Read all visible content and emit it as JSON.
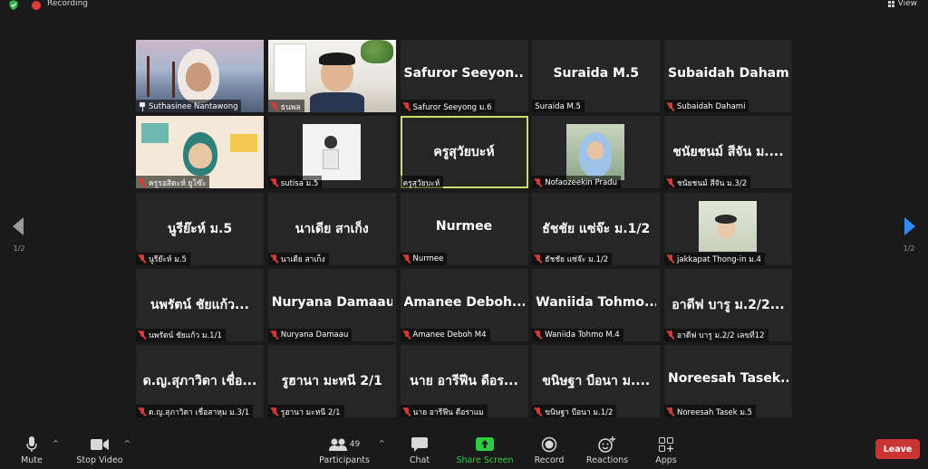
{
  "topbar": {
    "recording_label": "Recording",
    "view_label": "View"
  },
  "nav": {
    "page_indicator_left": "1/2",
    "page_indicator_right": "1/2"
  },
  "participants": [
    {
      "big_name": "",
      "label": "Suthasinee Nantawong",
      "icon": "pin-icon",
      "video": "sea"
    },
    {
      "big_name": "",
      "label": "ธนพล",
      "icon": "mic-off-icon",
      "video": "room"
    },
    {
      "big_name": "Safuror  Seeyon...",
      "label": "Safuror Seeyong ม.6",
      "icon": "mic-off-icon",
      "video": ""
    },
    {
      "big_name": "Suraida M.5",
      "label": "Suraida M.5",
      "icon": "",
      "video": ""
    },
    {
      "big_name": "Subaidah Dahami",
      "label": "Subaidah Dahami",
      "icon": "mic-off-icon",
      "video": ""
    },
    {
      "big_name": "",
      "label": "ครูรอสิดะห์ ยูโซ๊ะ",
      "icon": "mic-off-icon",
      "video": "cartoon"
    },
    {
      "big_name": "",
      "label": "sutisa ม.5",
      "icon": "mic-off-icon",
      "video": "thumb-girl"
    },
    {
      "big_name": "ครูสุวัยบะห์",
      "label": "ครูสุวัยบะห์",
      "icon": "",
      "video": "",
      "active": true
    },
    {
      "big_name": "",
      "label": "Nofaozeekin Pradu",
      "icon": "mic-off-icon",
      "video": "thumb-hijab"
    },
    {
      "big_name": "ชนัยชนม์ สีจัน ม....",
      "label": "ชนัยชนม์ สีจัน ม.3/2",
      "icon": "mic-off-icon",
      "video": ""
    },
    {
      "big_name": "นูรีย๊ะห์ ม.5",
      "label": "นูรีย๊ะห์ ม.5",
      "icon": "mic-off-icon",
      "video": ""
    },
    {
      "big_name": "นาเดีย สาเก็ง",
      "label": "นาเดีย สาเก็ง",
      "icon": "mic-off-icon",
      "video": ""
    },
    {
      "big_name": "Nurmee",
      "label": "Nurmee",
      "icon": "mic-off-icon",
      "video": ""
    },
    {
      "big_name": "ธัชชัย แซ่จ๊ะ ม.1/2",
      "label": "ธัชชัย แซ่จ๊ะ ม.1/2",
      "icon": "mic-off-icon",
      "video": ""
    },
    {
      "big_name": "",
      "label": "jakkapat Thong-in ม.4",
      "icon": "mic-off-icon",
      "video": "thumb-boy"
    },
    {
      "big_name": "นพรัตน์ ชัยแก้ว...",
      "label": "นพรัตน์ ชัยแก้ว ม.1/1",
      "icon": "mic-off-icon",
      "video": ""
    },
    {
      "big_name": "Nuryana Damaau",
      "label": "Nuryana Damaau",
      "icon": "mic-off-icon",
      "video": ""
    },
    {
      "big_name": "Amanee  Deboh...",
      "label": "Amanee Deboh M4",
      "icon": "mic-off-icon",
      "video": ""
    },
    {
      "big_name": "Waniida  Tohmo...",
      "label": "Waniida Tohmo M.4",
      "icon": "mic-off-icon",
      "video": ""
    },
    {
      "big_name": "อาดีฟ บารู ม.2/2...",
      "label": "อาดีฟ บารู ม.2/2 เลขที่12",
      "icon": "mic-off-icon",
      "video": ""
    },
    {
      "big_name": "ด.ญ.สุภาวิดา เชื่อ...",
      "label": "ด.ญ.สุภาวิดา เชื่อสาหุม ม.3/1",
      "icon": "mic-off-icon",
      "video": ""
    },
    {
      "big_name": "รูฮานา มะหนี 2/1",
      "label": "รูฮานา มะหนี 2/1",
      "icon": "mic-off-icon",
      "video": ""
    },
    {
      "big_name": "นาย อารีฟีน ดือร...",
      "label": "นาย อารีฟีน ดือราแม",
      "icon": "mic-off-icon",
      "video": ""
    },
    {
      "big_name": "ขนิษฐา บือนา ม....",
      "label": "ขนิษฐา บือนา ม.1/2",
      "icon": "mic-off-icon",
      "video": ""
    },
    {
      "big_name": "Noreesah  Tasek...",
      "label": "Noreesah Tasek ม.5",
      "icon": "mic-off-icon",
      "video": ""
    }
  ],
  "toolbar": {
    "mute_label": "Mute",
    "stop_video_label": "Stop Video",
    "participants_label": "Participants",
    "participants_count": "49",
    "chat_label": "Chat",
    "share_screen_label": "Share Screen",
    "record_label": "Record",
    "reactions_label": "Reactions",
    "apps_label": "Apps",
    "leave_label": "Leave",
    "share_color": "#2ecc40",
    "leave_color": "#c93434"
  }
}
